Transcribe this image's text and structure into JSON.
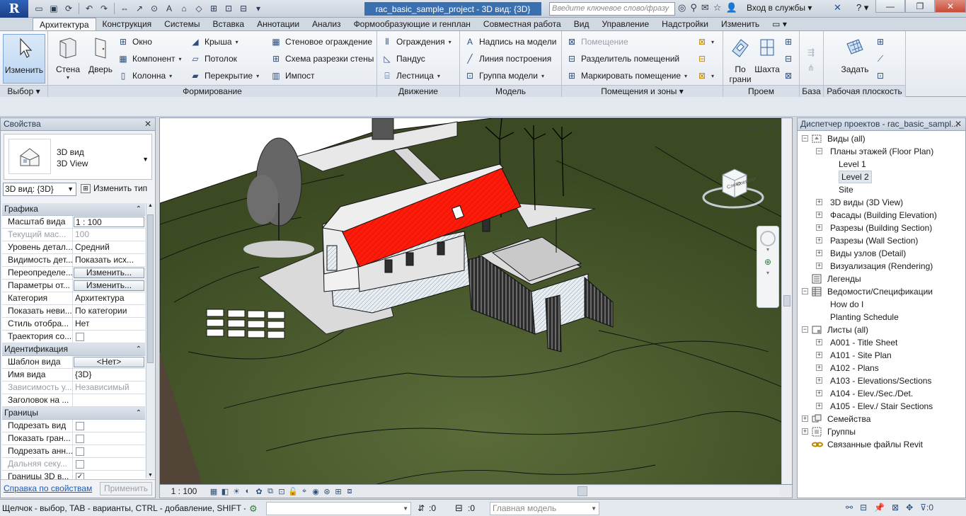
{
  "app": {
    "logo": "R",
    "doc_title": "rac_basic_sample_project - 3D вид: {3D}",
    "search_placeholder": "Введите ключевое слово/фразу",
    "login": "Вход в службы",
    "help": "?"
  },
  "ribbon_tabs": [
    "Архитектура",
    "Конструкция",
    "Системы",
    "Вставка",
    "Аннотации",
    "Анализ",
    "Формообразующие и генплан",
    "Совместная работа",
    "Вид",
    "Управление",
    "Надстройки",
    "Изменить"
  ],
  "ribbon": {
    "select": {
      "modify": "Изменить",
      "title": "Выбор"
    },
    "build": {
      "wall": "Стена",
      "door": "Дверь",
      "window": "Окно",
      "component": "Компонент",
      "column": "Колонна",
      "roof": "Крыша",
      "ceiling": "Потолок",
      "floor": "Перекрытие",
      "curtain_system": "Стеновое ограждение",
      "curtain_grid": "Схема разрезки стены",
      "mullion": "Импост",
      "title": "Формирование"
    },
    "circulation": {
      "railing": "Ограждения",
      "ramp": "Пандус",
      "stair": "Лестница",
      "title": "Движение"
    },
    "model": {
      "model_text": "Надпись на модели",
      "model_line": "Линия построения",
      "model_group": "Группа модели",
      "title": "Модель"
    },
    "room": {
      "room": "Помещение",
      "room_separator": "Разделитель помещений",
      "tag_room": "Маркировать помещение",
      "title": "Помещения и зоны"
    },
    "opening": {
      "by_face": "По грани",
      "shaft": "Шахта",
      "title": "Проем"
    },
    "datum": {
      "title": "База"
    },
    "workplane": {
      "set": "Задать",
      "title": "Рабочая плоскость"
    }
  },
  "properties": {
    "title": "Свойства",
    "type_line1": "3D вид",
    "type_line2": "3D View",
    "view_selector": "3D вид: {3D}",
    "edit_type": "Изменить тип",
    "groups": [
      {
        "name": "Графика",
        "rows": [
          {
            "k": "Масштаб вида",
            "v": "1 : 100",
            "kind": "box"
          },
          {
            "k": "Текущий мас...",
            "v": "100",
            "kind": "text",
            "disabled": true
          },
          {
            "k": "Уровень детал...",
            "v": "Средний",
            "kind": "text"
          },
          {
            "k": "Видимость дет...",
            "v": "Показать исх...",
            "kind": "text"
          },
          {
            "k": "Переопределе...",
            "v": "Изменить...",
            "kind": "button"
          },
          {
            "k": "Параметры от...",
            "v": "Изменить...",
            "kind": "button"
          },
          {
            "k": "Категория",
            "v": "Архитектура",
            "kind": "text"
          },
          {
            "k": "Показать неви...",
            "v": "По категории",
            "kind": "text"
          },
          {
            "k": "Стиль отобра...",
            "v": "Нет",
            "kind": "text"
          },
          {
            "k": "Траектория со...",
            "v": "",
            "kind": "check",
            "checked": false
          }
        ]
      },
      {
        "name": "Идентификация",
        "rows": [
          {
            "k": "Шаблон вида",
            "v": "<Нет>",
            "kind": "button"
          },
          {
            "k": "Имя вида",
            "v": "{3D}",
            "kind": "text"
          },
          {
            "k": "Зависимость у...",
            "v": "Независимый",
            "kind": "text",
            "disabled": true
          },
          {
            "k": "Заголовок на ...",
            "v": "",
            "kind": "text"
          }
        ]
      },
      {
        "name": "Границы",
        "rows": [
          {
            "k": "Подрезать вид",
            "v": "",
            "kind": "check",
            "checked": false
          },
          {
            "k": "Показать гран...",
            "v": "",
            "kind": "check",
            "checked": false
          },
          {
            "k": "Подрезать анн...",
            "v": "",
            "kind": "check",
            "checked": false
          },
          {
            "k": "Дальняя секу...",
            "v": "",
            "kind": "check",
            "checked": false,
            "disabled": true
          },
          {
            "k": "Границы 3D в...",
            "v": "",
            "kind": "check",
            "checked": true
          }
        ]
      }
    ],
    "help_link": "Справка по свойствам",
    "apply": "Применить"
  },
  "viewcube": {
    "left": "Слева",
    "front": "Спереди"
  },
  "viewbar": {
    "scale": "1 : 100"
  },
  "browser": {
    "title": "Диспетчер проектов - rac_basic_sampl...",
    "nodes": [
      {
        "label": "Виды (all)",
        "level": 0,
        "toggle": "−",
        "icon": "views"
      },
      {
        "label": "Планы этажей (Floor Plan)",
        "level": 1,
        "toggle": "−"
      },
      {
        "label": "Level 1",
        "level": 2
      },
      {
        "label": "Level 2",
        "level": 2,
        "selected": true
      },
      {
        "label": "Site",
        "level": 2
      },
      {
        "label": "3D виды (3D View)",
        "level": 1,
        "toggle": "+"
      },
      {
        "label": "Фасады (Building Elevation)",
        "level": 1,
        "toggle": "+"
      },
      {
        "label": "Разрезы (Building Section)",
        "level": 1,
        "toggle": "+"
      },
      {
        "label": "Разрезы (Wall Section)",
        "level": 1,
        "toggle": "+"
      },
      {
        "label": "Виды узлов (Detail)",
        "level": 1,
        "toggle": "+"
      },
      {
        "label": "Визуализация (Rendering)",
        "level": 1,
        "toggle": "+"
      },
      {
        "label": "Легенды",
        "level": 0,
        "icon": "legend"
      },
      {
        "label": "Ведомости/Спецификации",
        "level": 0,
        "toggle": "−",
        "icon": "schedule"
      },
      {
        "label": "How do I",
        "level": 1
      },
      {
        "label": "Planting Schedule",
        "level": 1
      },
      {
        "label": "Листы (all)",
        "level": 0,
        "toggle": "−",
        "icon": "sheet"
      },
      {
        "label": "A001 - Title Sheet",
        "level": 1,
        "toggle": "+"
      },
      {
        "label": "A101 - Site Plan",
        "level": 1,
        "toggle": "+"
      },
      {
        "label": "A102 - Plans",
        "level": 1,
        "toggle": "+"
      },
      {
        "label": "A103 - Elevations/Sections",
        "level": 1,
        "toggle": "+"
      },
      {
        "label": "A104 - Elev./Sec./Det.",
        "level": 1,
        "toggle": "+"
      },
      {
        "label": "A105 - Elev./ Stair Sections",
        "level": 1,
        "toggle": "+"
      },
      {
        "label": "Семейства",
        "level": 0,
        "toggle": "+",
        "icon": "family"
      },
      {
        "label": "Группы",
        "level": 0,
        "toggle": "+",
        "icon": "group"
      },
      {
        "label": "Связанные файлы Revit",
        "level": 0,
        "icon": "link"
      }
    ]
  },
  "status": {
    "hint": "Щелчок - выбор, TAB - варианты, CTRL - добавление, SHIFT - ",
    "count1": ":0",
    "count2": ":0",
    "model": "Главная модель"
  },
  "colors": {
    "roof": "#ff1a0a",
    "terrain": "#3b4a22",
    "accent": "#3a6fb0"
  }
}
